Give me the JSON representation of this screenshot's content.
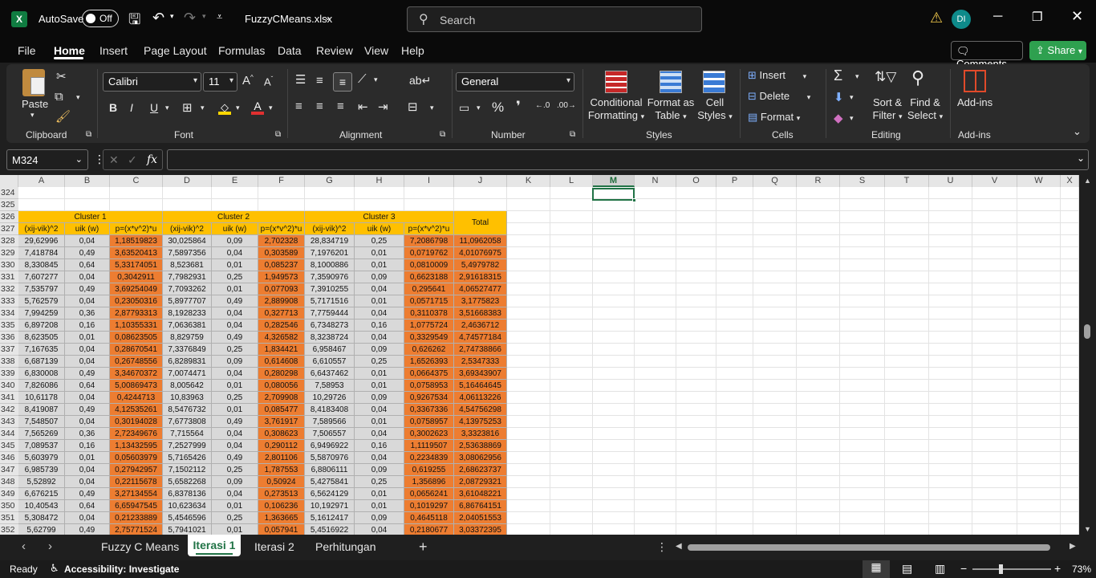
{
  "titlebar": {
    "autosave_label": "AutoSave",
    "toggle_label": "Off",
    "filename": "FuzzyCMeans.xlsx",
    "search_placeholder": "Search",
    "avatar": "DI"
  },
  "tabs": [
    "File",
    "Home",
    "Insert",
    "Page Layout",
    "Formulas",
    "Data",
    "Review",
    "View",
    "Help"
  ],
  "actions": {
    "comments": "Comments",
    "share": "Share"
  },
  "ribbon": {
    "clipboard": {
      "label": "Clipboard",
      "paste": "Paste"
    },
    "font": {
      "label": "Font",
      "name": "Calibri",
      "size": "11",
      "bold": "B",
      "italic": "I",
      "underline": "U"
    },
    "alignment": {
      "label": "Alignment"
    },
    "number": {
      "label": "Number",
      "format": "General"
    },
    "styles": {
      "label": "Styles",
      "conditional_1": "Conditional",
      "conditional_2": "Formatting",
      "format_table_1": "Format as",
      "format_table_2": "Table",
      "cell_styles_1": "Cell",
      "cell_styles_2": "Styles"
    },
    "cells": {
      "label": "Cells",
      "insert": "Insert",
      "delete": "Delete",
      "format": "Format"
    },
    "editing": {
      "label": "Editing",
      "sort_1": "Sort &",
      "sort_2": "Filter",
      "find_1": "Find &",
      "find_2": "Select"
    },
    "addins": {
      "label": "Add-ins",
      "button": "Add-ins"
    }
  },
  "formula_bar": {
    "name_box": "M324",
    "fx": "fx",
    "formula": ""
  },
  "columns": [
    "A",
    "B",
    "C",
    "D",
    "E",
    "F",
    "G",
    "H",
    "I",
    "J",
    "K",
    "L",
    "M",
    "N",
    "O",
    "P",
    "Q",
    "R",
    "S",
    "T",
    "U",
    "V",
    "W",
    "X"
  ],
  "selected_column": "M",
  "row_numbers": [
    "324",
    "325",
    "326",
    "327",
    "328",
    "329",
    "330",
    "331",
    "332",
    "333",
    "334",
    "335",
    "336",
    "337",
    "338",
    "339",
    "340",
    "341",
    "342",
    "343",
    "344",
    "345",
    "346",
    "347",
    "348",
    "349",
    "350",
    "351",
    "352"
  ],
  "table": {
    "cluster_headers": [
      "Cluster 1",
      "Cluster 2",
      "Cluster 3"
    ],
    "total_header": "Total",
    "sub_headers": [
      "(xij-vik)^2",
      "uik (w)",
      "p=(x*v^2)*u",
      "(xij-vik)^2",
      "uik (w)",
      "p=(x*v^2)*u",
      "(xij-vik)^2",
      "uik (w)",
      "p=(x*v^2)*u"
    ],
    "rows": [
      [
        "29,62996",
        "0,04",
        "1,18519823",
        "30,025864",
        "0,09",
        "2,702328",
        "28,834719",
        "0,25",
        "7,2086798",
        "11,0962058"
      ],
      [
        "7,418784",
        "0,49",
        "3,63520413",
        "7,5897356",
        "0,04",
        "0,303589",
        "7,1976201",
        "0,01",
        "0,0719762",
        "4,01076975"
      ],
      [
        "8,330845",
        "0,64",
        "5,33174051",
        "8,523681",
        "0,01",
        "0,085237",
        "8,1000886",
        "0,01",
        "0,0810009",
        "5,4979782"
      ],
      [
        "7,607277",
        "0,04",
        "0,3042911",
        "7,7982931",
        "0,25",
        "1,949573",
        "7,3590976",
        "0,09",
        "0,6623188",
        "2,91618315"
      ],
      [
        "7,535797",
        "0,49",
        "3,69254049",
        "7,7093262",
        "0,01",
        "0,077093",
        "7,3910255",
        "0,04",
        "0,295641",
        "4,06527477"
      ],
      [
        "5,762579",
        "0,04",
        "0,23050316",
        "5,8977707",
        "0,49",
        "2,889908",
        "5,7171516",
        "0,01",
        "0,0571715",
        "3,1775823"
      ],
      [
        "7,994259",
        "0,36",
        "2,87793313",
        "8,1928233",
        "0,04",
        "0,327713",
        "7,7759444",
        "0,04",
        "0,3110378",
        "3,51668383"
      ],
      [
        "6,897208",
        "0,16",
        "1,10355331",
        "7,0636381",
        "0,04",
        "0,282546",
        "6,7348273",
        "0,16",
        "1,0775724",
        "2,4636712"
      ],
      [
        "8,623505",
        "0,01",
        "0,08623505",
        "8,829759",
        "0,49",
        "4,326582",
        "8,3238724",
        "0,04",
        "0,3329549",
        "4,74577184"
      ],
      [
        "7,167635",
        "0,04",
        "0,28670541",
        "7,3376849",
        "0,25",
        "1,834421",
        "6,958467",
        "0,09",
        "0,626262",
        "2,74738866"
      ],
      [
        "6,687139",
        "0,04",
        "0,26748556",
        "6,8289831",
        "0,09",
        "0,614608",
        "6,610557",
        "0,25",
        "1,6526393",
        "2,5347333"
      ],
      [
        "6,830008",
        "0,49",
        "3,34670372",
        "7,0074471",
        "0,04",
        "0,280298",
        "6,6437462",
        "0,01",
        "0,0664375",
        "3,69343907"
      ],
      [
        "7,826086",
        "0,64",
        "5,00869473",
        "8,005642",
        "0,01",
        "0,080056",
        "7,58953",
        "0,01",
        "0,0758953",
        "5,16464645"
      ],
      [
        "10,61178",
        "0,04",
        "0,4244713",
        "10,83963",
        "0,25",
        "2,709908",
        "10,29726",
        "0,09",
        "0,9267534",
        "4,06113226"
      ],
      [
        "8,419087",
        "0,49",
        "4,12535261",
        "8,5476732",
        "0,01",
        "0,085477",
        "8,4183408",
        "0,04",
        "0,3367336",
        "4,54756298"
      ],
      [
        "7,548507",
        "0,04",
        "0,30194028",
        "7,6773808",
        "0,49",
        "3,761917",
        "7,589566",
        "0,01",
        "0,0758957",
        "4,13975253"
      ],
      [
        "7,565269",
        "0,36",
        "2,72349676",
        "7,715564",
        "0,04",
        "0,308623",
        "7,506557",
        "0,04",
        "0,3002623",
        "3,3323816"
      ],
      [
        "7,089537",
        "0,16",
        "1,13432595",
        "7,2527999",
        "0,04",
        "0,290112",
        "6,9496922",
        "0,16",
        "1,1119507",
        "2,53638869"
      ],
      [
        "5,603979",
        "0,01",
        "0,05603979",
        "5,7165426",
        "0,49",
        "2,801106",
        "5,5870976",
        "0,04",
        "0,2234839",
        "3,08062956"
      ],
      [
        "6,985739",
        "0,04",
        "0,27942957",
        "7,1502112",
        "0,25",
        "1,787553",
        "6,8806111",
        "0,09",
        "0,619255",
        "2,68623737"
      ],
      [
        "5,52892",
        "0,04",
        "0,22115678",
        "5,6582268",
        "0,09",
        "0,50924",
        "5,4275841",
        "0,25",
        "1,356896",
        "2,08729321"
      ],
      [
        "6,676215",
        "0,49",
        "3,27134554",
        "6,8378136",
        "0,04",
        "0,273513",
        "6,5624129",
        "0,01",
        "0,0656241",
        "3,61048221"
      ],
      [
        "10,40543",
        "0,64",
        "6,65947545",
        "10,623634",
        "0,01",
        "0,106236",
        "10,192971",
        "0,01",
        "0,1019297",
        "6,86764151"
      ],
      [
        "5,308472",
        "0,04",
        "0,21233889",
        "5,4546596",
        "0,25",
        "1,363665",
        "5,1612417",
        "0,09",
        "0,4645118",
        "2,04051553"
      ],
      [
        "5,62799",
        "0,49",
        "2,75771524",
        "5,7941021",
        "0,01",
        "0,057941",
        "5,4516922",
        "0,04",
        "0,2180677",
        "3,03372395"
      ]
    ]
  },
  "sheets": [
    "Fuzzy C Means",
    "Iterasi 1",
    "Iterasi 2",
    "Perhitungan"
  ],
  "active_sheet": "Iterasi 1",
  "status": {
    "ready": "Ready",
    "accessibility": "Accessibility: Investigate",
    "zoom": "73%"
  },
  "colors": {
    "excel_green": "#217346",
    "orange": "#ed7d31",
    "gray": "#d9d9d9",
    "yellow": "#ffc000",
    "share_green": "#2ea04f"
  }
}
